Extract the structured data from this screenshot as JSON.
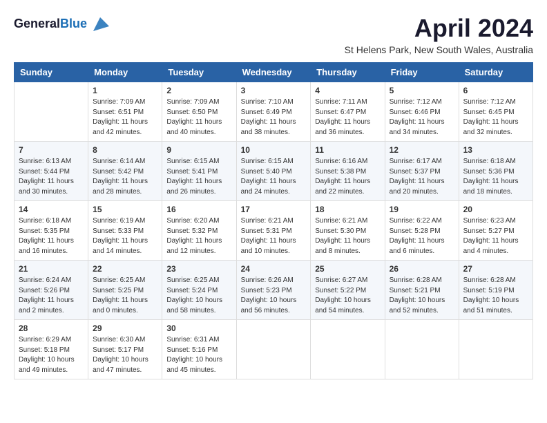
{
  "header": {
    "logo_line1": "General",
    "logo_line2": "Blue",
    "month_title": "April 2024",
    "location": "St Helens Park, New South Wales, Australia"
  },
  "days_of_week": [
    "Sunday",
    "Monday",
    "Tuesday",
    "Wednesday",
    "Thursday",
    "Friday",
    "Saturday"
  ],
  "weeks": [
    [
      {
        "day": "",
        "info": ""
      },
      {
        "day": "1",
        "info": "Sunrise: 7:09 AM\nSunset: 6:51 PM\nDaylight: 11 hours\nand 42 minutes."
      },
      {
        "day": "2",
        "info": "Sunrise: 7:09 AM\nSunset: 6:50 PM\nDaylight: 11 hours\nand 40 minutes."
      },
      {
        "day": "3",
        "info": "Sunrise: 7:10 AM\nSunset: 6:49 PM\nDaylight: 11 hours\nand 38 minutes."
      },
      {
        "day": "4",
        "info": "Sunrise: 7:11 AM\nSunset: 6:47 PM\nDaylight: 11 hours\nand 36 minutes."
      },
      {
        "day": "5",
        "info": "Sunrise: 7:12 AM\nSunset: 6:46 PM\nDaylight: 11 hours\nand 34 minutes."
      },
      {
        "day": "6",
        "info": "Sunrise: 7:12 AM\nSunset: 6:45 PM\nDaylight: 11 hours\nand 32 minutes."
      }
    ],
    [
      {
        "day": "7",
        "info": "Sunrise: 6:13 AM\nSunset: 5:44 PM\nDaylight: 11 hours\nand 30 minutes."
      },
      {
        "day": "8",
        "info": "Sunrise: 6:14 AM\nSunset: 5:42 PM\nDaylight: 11 hours\nand 28 minutes."
      },
      {
        "day": "9",
        "info": "Sunrise: 6:15 AM\nSunset: 5:41 PM\nDaylight: 11 hours\nand 26 minutes."
      },
      {
        "day": "10",
        "info": "Sunrise: 6:15 AM\nSunset: 5:40 PM\nDaylight: 11 hours\nand 24 minutes."
      },
      {
        "day": "11",
        "info": "Sunrise: 6:16 AM\nSunset: 5:38 PM\nDaylight: 11 hours\nand 22 minutes."
      },
      {
        "day": "12",
        "info": "Sunrise: 6:17 AM\nSunset: 5:37 PM\nDaylight: 11 hours\nand 20 minutes."
      },
      {
        "day": "13",
        "info": "Sunrise: 6:18 AM\nSunset: 5:36 PM\nDaylight: 11 hours\nand 18 minutes."
      }
    ],
    [
      {
        "day": "14",
        "info": "Sunrise: 6:18 AM\nSunset: 5:35 PM\nDaylight: 11 hours\nand 16 minutes."
      },
      {
        "day": "15",
        "info": "Sunrise: 6:19 AM\nSunset: 5:33 PM\nDaylight: 11 hours\nand 14 minutes."
      },
      {
        "day": "16",
        "info": "Sunrise: 6:20 AM\nSunset: 5:32 PM\nDaylight: 11 hours\nand 12 minutes."
      },
      {
        "day": "17",
        "info": "Sunrise: 6:21 AM\nSunset: 5:31 PM\nDaylight: 11 hours\nand 10 minutes."
      },
      {
        "day": "18",
        "info": "Sunrise: 6:21 AM\nSunset: 5:30 PM\nDaylight: 11 hours\nand 8 minutes."
      },
      {
        "day": "19",
        "info": "Sunrise: 6:22 AM\nSunset: 5:28 PM\nDaylight: 11 hours\nand 6 minutes."
      },
      {
        "day": "20",
        "info": "Sunrise: 6:23 AM\nSunset: 5:27 PM\nDaylight: 11 hours\nand 4 minutes."
      }
    ],
    [
      {
        "day": "21",
        "info": "Sunrise: 6:24 AM\nSunset: 5:26 PM\nDaylight: 11 hours\nand 2 minutes."
      },
      {
        "day": "22",
        "info": "Sunrise: 6:25 AM\nSunset: 5:25 PM\nDaylight: 11 hours\nand 0 minutes."
      },
      {
        "day": "23",
        "info": "Sunrise: 6:25 AM\nSunset: 5:24 PM\nDaylight: 10 hours\nand 58 minutes."
      },
      {
        "day": "24",
        "info": "Sunrise: 6:26 AM\nSunset: 5:23 PM\nDaylight: 10 hours\nand 56 minutes."
      },
      {
        "day": "25",
        "info": "Sunrise: 6:27 AM\nSunset: 5:22 PM\nDaylight: 10 hours\nand 54 minutes."
      },
      {
        "day": "26",
        "info": "Sunrise: 6:28 AM\nSunset: 5:21 PM\nDaylight: 10 hours\nand 52 minutes."
      },
      {
        "day": "27",
        "info": "Sunrise: 6:28 AM\nSunset: 5:19 PM\nDaylight: 10 hours\nand 51 minutes."
      }
    ],
    [
      {
        "day": "28",
        "info": "Sunrise: 6:29 AM\nSunset: 5:18 PM\nDaylight: 10 hours\nand 49 minutes."
      },
      {
        "day": "29",
        "info": "Sunrise: 6:30 AM\nSunset: 5:17 PM\nDaylight: 10 hours\nand 47 minutes."
      },
      {
        "day": "30",
        "info": "Sunrise: 6:31 AM\nSunset: 5:16 PM\nDaylight: 10 hours\nand 45 minutes."
      },
      {
        "day": "",
        "info": ""
      },
      {
        "day": "",
        "info": ""
      },
      {
        "day": "",
        "info": ""
      },
      {
        "day": "",
        "info": ""
      }
    ]
  ]
}
